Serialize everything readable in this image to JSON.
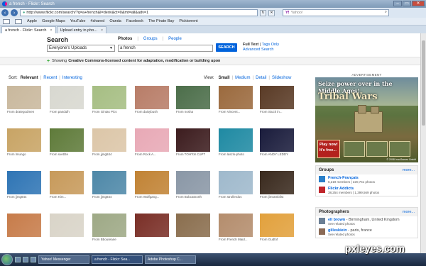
{
  "window": {
    "title": "a french - Flickr: Search",
    "buttons": [
      "–",
      "▭",
      "✕"
    ]
  },
  "browser": {
    "url": "http://www.flickr.com/search/?q=a+french&l=deriv&ct=0&mt=all&adv=1",
    "search_placeholder": "Yahoo!",
    "search_logo": "Y!",
    "bookmarks": [
      "Apple",
      "Google Maps",
      "YouTube",
      "4shared",
      "Oanda",
      "Facebook",
      "The Pirate Bay",
      "Picktorrent"
    ],
    "tabs": [
      {
        "label": "a french - Flickr: Search",
        "active": true
      },
      {
        "label": "Upload entry in pho...",
        "active": false
      }
    ]
  },
  "search": {
    "title": "Search",
    "tabs": [
      "Photos",
      "Groups",
      "People"
    ],
    "scope": "Everyone's Uploads",
    "query": "a french",
    "button": "SEARCH",
    "full_text": "Full Text",
    "tags_only": "Tags Only",
    "advanced": "Advanced Search",
    "cc_prefix": "Showing",
    "cc_bold": "Creative Commons-licensed content for adaptation, modification or building upon",
    "sort_label": "Sort:",
    "sort_options": [
      "Relevant",
      "Recent",
      "Interesting"
    ],
    "view_label": "View:",
    "view_options": [
      "Small",
      "Medium",
      "Detail",
      "Slideshow"
    ]
  },
  "photos": [
    {
      "caption": "From drategodmen",
      "color": "#c9b89d"
    },
    {
      "caption": "From pandulh",
      "color": "#d8d8d0"
    },
    {
      "caption": "From Gintas Pics",
      "color": "#a6be83"
    },
    {
      "caption": "From daisybush",
      "color": "#b87d68"
    },
    {
      "caption": "From nosha",
      "color": "#4c6e4a"
    },
    {
      "caption": "From Vincent...",
      "color": "#9b6a3e"
    },
    {
      "caption": "From Stuck in...",
      "color": "#5a3b26"
    },
    {
      "caption": "From lmungo",
      "color": "#c8a465"
    },
    {
      "caption": "From svetl2e",
      "color": "#5f7b3a"
    },
    {
      "caption": "From jjmg844",
      "color": "#dcc6a8"
    },
    {
      "caption": "From Rock A...",
      "color": "#e8a9b6"
    },
    {
      "caption": "From TOHToh CoPT",
      "color": "#3c1c1e"
    },
    {
      "caption": "From laszlo-photo",
      "color": "#1f8aa3"
    },
    {
      "caption": "From ANDY LEDDY",
      "color": "#1a1c3c"
    },
    {
      "caption": "From jjmg844",
      "color": "#2f75b5"
    },
    {
      "caption": "From Kim...",
      "color": "#c79a5b"
    },
    {
      "caption": "From jjmg844",
      "color": "#4e88a8"
    },
    {
      "caption": "From Wolfgang...",
      "color": "#c18335"
    },
    {
      "caption": "From Bobcatnorth",
      "color": "#8a97a6"
    },
    {
      "caption": "From strollerdos",
      "color": "#9fb9cc"
    },
    {
      "caption": "From jimramblist",
      "color": "#3a2a1e"
    },
    {
      "caption": "",
      "color": "#c77c4a"
    },
    {
      "caption": "",
      "color": "#d9d4c8"
    },
    {
      "caption": "From Bboureane",
      "color": "#9ea986"
    },
    {
      "caption": "",
      "color": "#7a2f27"
    },
    {
      "caption": "",
      "color": "#8a6e4e"
    },
    {
      "caption": "From French Maid...",
      "color": "#b48d6d"
    },
    {
      "caption": "From Gudfof",
      "color": "#e2a13d"
    }
  ],
  "ad": {
    "label": "ADVERTISEMENT",
    "headline": "Seize power over in the Middle Ages!",
    "brand": "Tribal Wars",
    "cta": "Play now! It's free...",
    "copyright": "© 2008 InnoGames GmbH"
  },
  "groups": {
    "title": "Groups",
    "more": "more...",
    "items": [
      {
        "name": "French-Français",
        "stats": "6,219 members | 220,741 photos",
        "color": "#2a7fc9"
      },
      {
        "name": "Flickr Addicts",
        "stats": "38,254 members | 1,399,569 photos",
        "color": "#c0262c"
      }
    ]
  },
  "photographers": {
    "title": "Photographers",
    "more": "more...",
    "items": [
      {
        "name": "ell brown",
        "location": "- Birmingham, United Kingdom",
        "link": "See related photos",
        "color": "#6b7f95"
      },
      {
        "name": "gilleskiein",
        "location": "- paris, france",
        "link": "See related photos",
        "color": "#8a6a56"
      }
    ]
  },
  "taskbar": {
    "tasks": [
      "Yahoo! Messenger",
      "a french - Flickr: Sea...",
      "Adobe Photoshop C..."
    ],
    "watermark": "pxleyes.com"
  }
}
